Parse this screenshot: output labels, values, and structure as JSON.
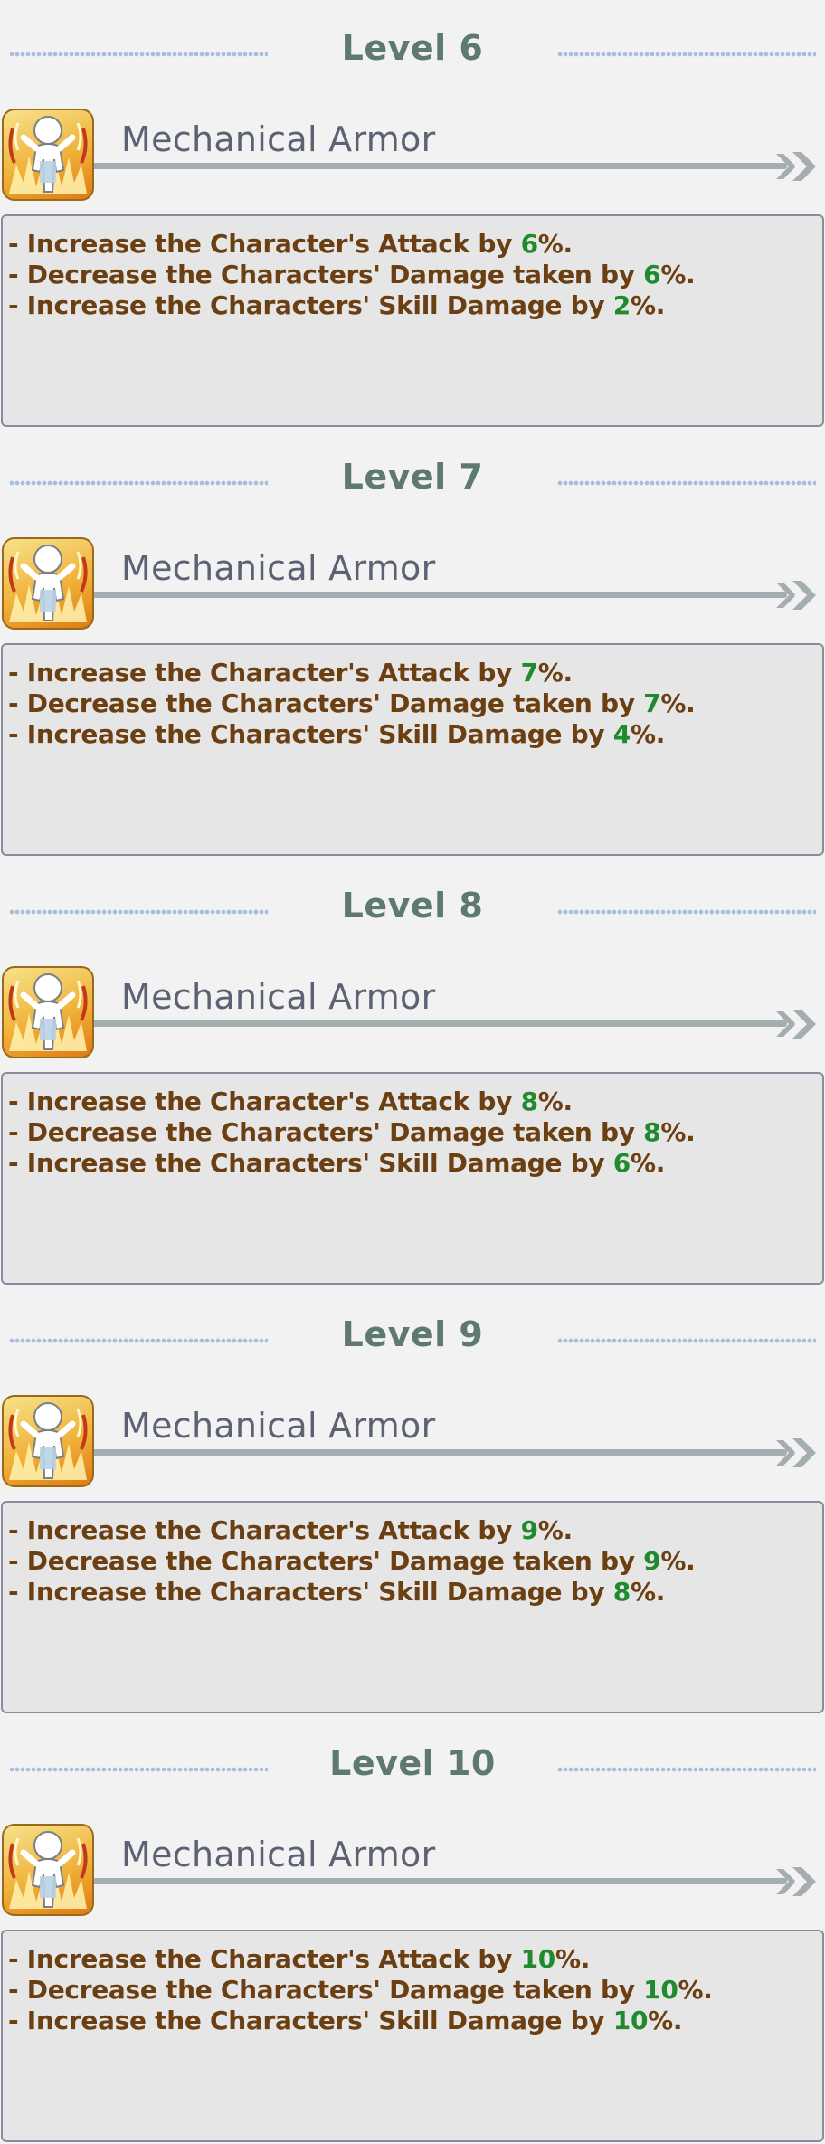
{
  "skill_name": "Mechanical Armor",
  "levels": [
    {
      "title": "Level 6",
      "lines": [
        {
          "prefix": "- Increase the Character's Attack by ",
          "value": "6",
          "suffix": "%."
        },
        {
          "prefix": "- Decrease the Characters' Damage taken by ",
          "value": "6",
          "suffix": "%."
        },
        {
          "prefix": "- Increase the Characters' Skill Damage by ",
          "value": "2",
          "suffix": "%."
        }
      ]
    },
    {
      "title": "Level 7",
      "lines": [
        {
          "prefix": "- Increase the Character's Attack by ",
          "value": "7",
          "suffix": "%."
        },
        {
          "prefix": "- Decrease the Characters' Damage taken by ",
          "value": "7",
          "suffix": "%."
        },
        {
          "prefix": "- Increase the Characters' Skill Damage by ",
          "value": "4",
          "suffix": "%."
        }
      ]
    },
    {
      "title": "Level 8",
      "lines": [
        {
          "prefix": "- Increase the Character's Attack by ",
          "value": "8",
          "suffix": "%."
        },
        {
          "prefix": "- Decrease the Characters' Damage taken by ",
          "value": "8",
          "suffix": "%."
        },
        {
          "prefix": "- Increase the Characters' Skill Damage by ",
          "value": "6",
          "suffix": "%."
        }
      ]
    },
    {
      "title": "Level 9",
      "lines": [
        {
          "prefix": "- Increase the Character's Attack by ",
          "value": "9",
          "suffix": "%."
        },
        {
          "prefix": "- Decrease the Characters' Damage taken by ",
          "value": "9",
          "suffix": "%."
        },
        {
          "prefix": "- Increase the Characters' Skill Damage by ",
          "value": "8",
          "suffix": "%."
        }
      ]
    },
    {
      "title": "Level 10",
      "lines": [
        {
          "prefix": "- Increase the Character's Attack by ",
          "value": "10",
          "suffix": "%."
        },
        {
          "prefix": "- Decrease the Characters' Damage taken by ",
          "value": "10",
          "suffix": "%."
        },
        {
          "prefix": "- Increase the Characters' Skill Damage by ",
          "value": "10",
          "suffix": "%."
        }
      ]
    }
  ],
  "icons": {
    "skill_icon": "mechanical-armor-skill-icon",
    "arrow_icon": "double-chevron-right-icon"
  },
  "colors": {
    "level_title": "#5e7a6e",
    "skill_name": "#5c6274",
    "description_text": "#6b3f12",
    "highlight_value": "#1f8a2e",
    "dotted_rule": "#a9bede",
    "description_background": "#e6e6e6"
  }
}
